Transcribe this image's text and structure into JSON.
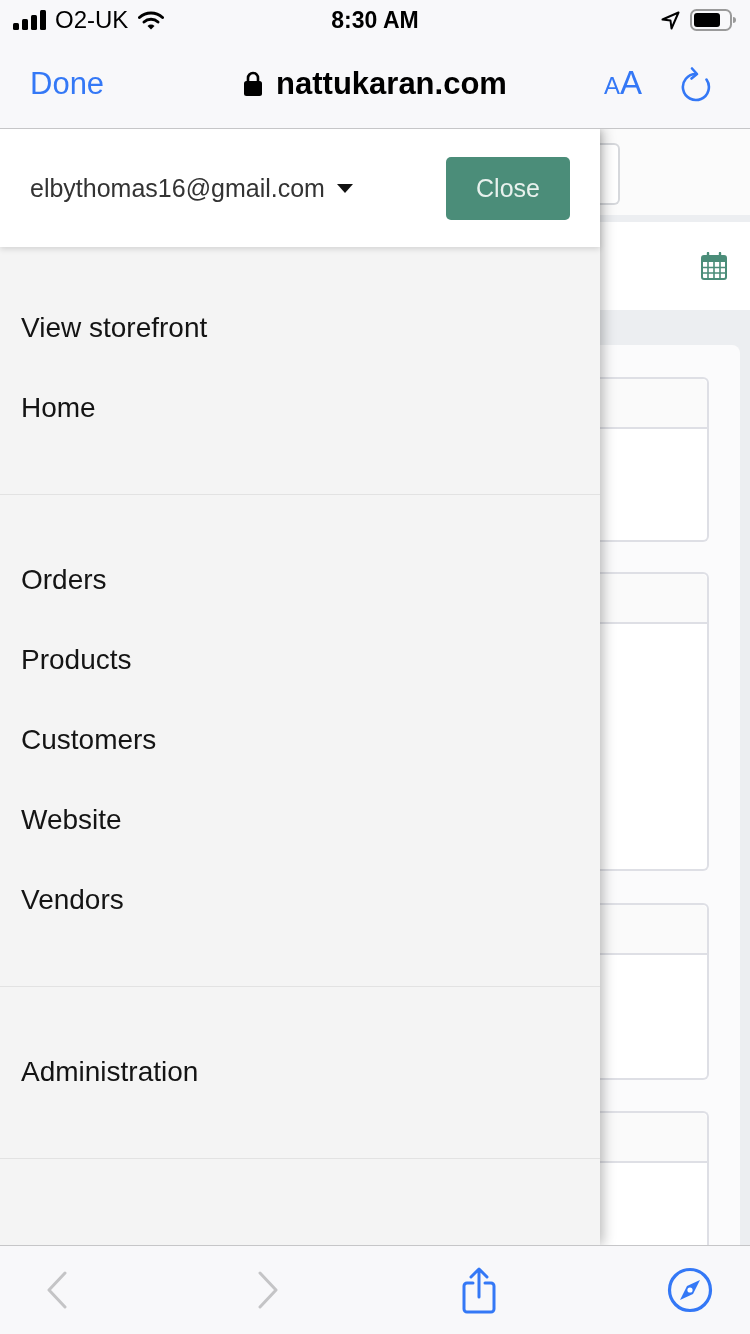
{
  "status_bar": {
    "carrier": "O2-UK",
    "time": "8:30 AM"
  },
  "browser_bar": {
    "done_button": "Done",
    "url": "nattukaran.com",
    "text_size_button": "AA"
  },
  "drawer": {
    "account_email": "elbythomas16@gmail.com",
    "close_button": "Close",
    "sections": [
      {
        "items": [
          {
            "label": "View storefront"
          },
          {
            "label": "Home"
          }
        ]
      },
      {
        "items": [
          {
            "label": "Orders"
          },
          {
            "label": "Products"
          },
          {
            "label": "Customers"
          },
          {
            "label": "Website"
          },
          {
            "label": "Vendors"
          }
        ]
      },
      {
        "items": [
          {
            "label": "Administration"
          }
        ]
      }
    ]
  },
  "toolbar": {
    "buttons": [
      {
        "kind": "back",
        "disabled": true
      },
      {
        "kind": "forward",
        "disabled": true
      },
      {
        "kind": "share",
        "disabled": false
      },
      {
        "kind": "compass",
        "disabled": false
      }
    ]
  }
}
